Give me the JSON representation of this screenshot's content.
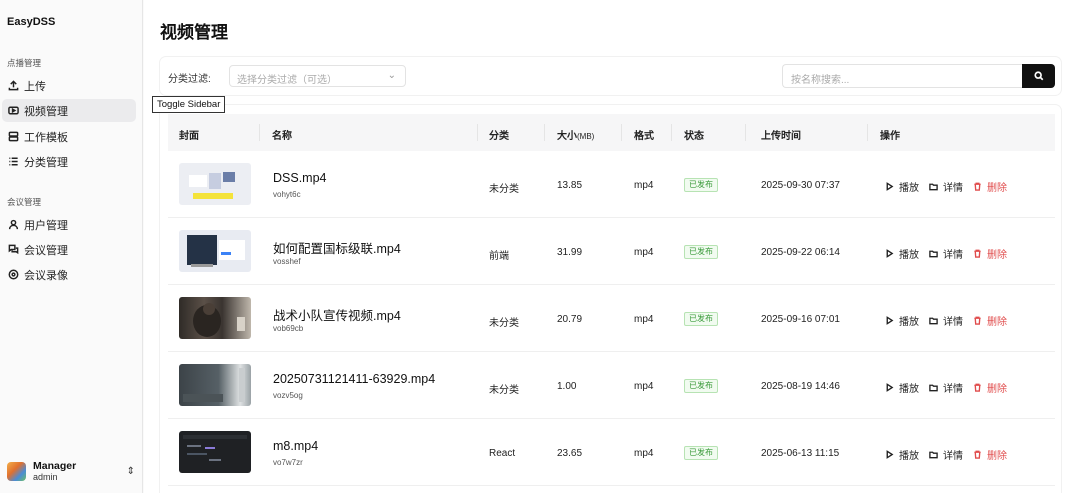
{
  "sidebar": {
    "brand": "EasyDSS",
    "group1": "点播管理",
    "group2": "会议管理",
    "items": [
      {
        "label": "上传",
        "icon": "upload-icon"
      },
      {
        "label": "视频管理",
        "icon": "video-icon"
      },
      {
        "label": "工作模板",
        "icon": "template-icon"
      },
      {
        "label": "分类管理",
        "icon": "list-icon"
      },
      {
        "label": "用户管理",
        "icon": "user-icon"
      },
      {
        "label": "会议管理",
        "icon": "chat-icon"
      },
      {
        "label": "会议录像",
        "icon": "record-icon"
      }
    ],
    "user": {
      "name": "Manager",
      "role": "admin"
    }
  },
  "tooltip": "Toggle Sidebar",
  "page_title": "视频管理",
  "filter": {
    "label": "分类过滤:",
    "select_placeholder": "选择分类过滤（可选）",
    "search_placeholder": "按名称搜索..."
  },
  "table": {
    "headers": {
      "cover": "封面",
      "name": "名称",
      "category": "分类",
      "size": "大小",
      "size_unit": "(MB)",
      "format": "格式",
      "status": "状态",
      "upload_time": "上传时间",
      "actions": "操作"
    },
    "rows": [
      {
        "name": "DSS.mp4",
        "id": "vohyt6c",
        "category": "未分类",
        "size": "13.85",
        "format": "mp4",
        "status": "已发布",
        "time": "2025-09-30 07:37"
      },
      {
        "name": "如何配置国标级联.mp4",
        "id": "vosshef",
        "category": "前端",
        "size": "31.99",
        "format": "mp4",
        "status": "已发布",
        "time": "2025-09-22 06:14"
      },
      {
        "name": "战术小队宣传视频.mp4",
        "id": "vob69cb",
        "category": "未分类",
        "size": "20.79",
        "format": "mp4",
        "status": "已发布",
        "time": "2025-09-16 07:01"
      },
      {
        "name": "20250731121411-63929.mp4",
        "id": "vozv5og",
        "category": "未分类",
        "size": "1.00",
        "format": "mp4",
        "status": "已发布",
        "time": "2025-08-19 14:46"
      },
      {
        "name": "m8.mp4",
        "id": "vo7w7zr",
        "category": "React",
        "size": "23.65",
        "format": "mp4",
        "status": "已发布",
        "time": "2025-06-13 11:15"
      }
    ],
    "actions": {
      "play": "播放",
      "detail": "详情",
      "delete": "删除"
    }
  },
  "colors": {
    "accent": "#111111",
    "success": "#3a9a3a",
    "danger": "#e04b4b"
  }
}
